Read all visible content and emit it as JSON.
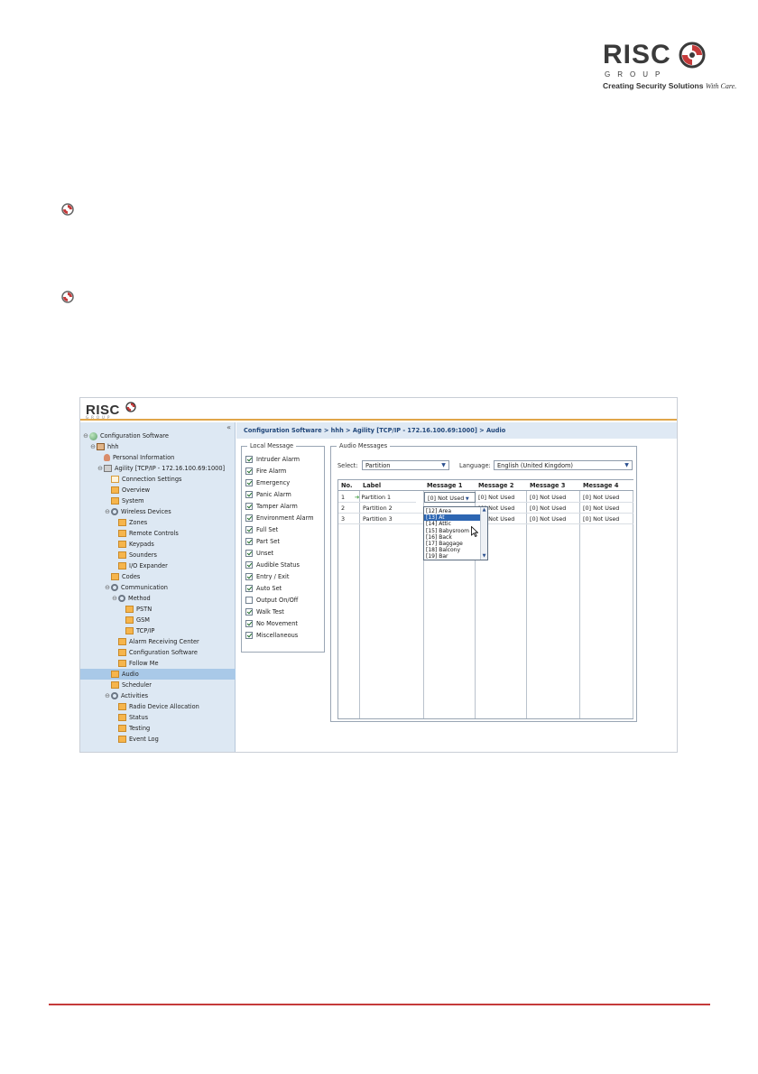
{
  "brand": {
    "logo_word": "RISC",
    "logo_group": "GROUP",
    "tagline": "Creating Security Solutions",
    "tagline_script": "With Care."
  },
  "app": {
    "logo_word": "RISC",
    "logo_group": "GROUP",
    "collapse_symbol": "«",
    "breadcrumb": "Configuration Software > hhh > Agility [TCP/IP - 172.16.100.69:1000] > Audio",
    "tree": [
      {
        "label": "Configuration Software",
        "icon": "globe-icon",
        "toggle": "⊖"
      },
      {
        "label": "hhh",
        "icon": "house-icon",
        "toggle": "⊖"
      },
      {
        "label": "Personal Information",
        "icon": "person-icon",
        "toggle": ""
      },
      {
        "label": "Agility [TCP/IP - 172.16.100.69:1000]",
        "icon": "panel-icon",
        "toggle": "⊖"
      },
      {
        "label": "Connection Settings",
        "icon": "page-icon",
        "toggle": ""
      },
      {
        "label": "Overview",
        "icon": "folder-icon",
        "toggle": ""
      },
      {
        "label": "System",
        "icon": "folder-icon",
        "toggle": ""
      },
      {
        "label": "Wireless Devices",
        "icon": "gear-icon",
        "toggle": "⊖"
      },
      {
        "label": "Zones",
        "icon": "folder-icon",
        "toggle": ""
      },
      {
        "label": "Remote Controls",
        "icon": "folder-icon",
        "toggle": ""
      },
      {
        "label": "Keypads",
        "icon": "folder-icon",
        "toggle": ""
      },
      {
        "label": "Sounders",
        "icon": "folder-icon",
        "toggle": ""
      },
      {
        "label": "I/O Expander",
        "icon": "folder-icon",
        "toggle": ""
      },
      {
        "label": "Codes",
        "icon": "folder-icon",
        "toggle": ""
      },
      {
        "label": "Communication",
        "icon": "gear-icon",
        "toggle": "⊖"
      },
      {
        "label": "Method",
        "icon": "gear-icon",
        "toggle": "⊖"
      },
      {
        "label": "PSTN",
        "icon": "folder-icon",
        "toggle": ""
      },
      {
        "label": "GSM",
        "icon": "folder-icon",
        "toggle": ""
      },
      {
        "label": "TCP/IP",
        "icon": "folder-icon",
        "toggle": ""
      },
      {
        "label": "Alarm Receiving Center",
        "icon": "folder-icon",
        "toggle": ""
      },
      {
        "label": "Configuration Software",
        "icon": "folder-icon",
        "toggle": ""
      },
      {
        "label": "Follow Me",
        "icon": "folder-icon",
        "toggle": ""
      },
      {
        "label": "Audio",
        "icon": "folder-icon",
        "toggle": ""
      },
      {
        "label": "Scheduler",
        "icon": "folder-icon",
        "toggle": ""
      },
      {
        "label": "Activities",
        "icon": "gear-icon",
        "toggle": "⊖"
      },
      {
        "label": "Radio Device Allocation",
        "icon": "folder-icon",
        "toggle": ""
      },
      {
        "label": "Status",
        "icon": "folder-icon",
        "toggle": ""
      },
      {
        "label": "Testing",
        "icon": "folder-icon",
        "toggle": ""
      },
      {
        "label": "Event Log",
        "icon": "folder-icon",
        "toggle": ""
      }
    ],
    "local_message": {
      "title": "Local Message",
      "items": [
        {
          "label": "Intruder Alarm",
          "checked": true
        },
        {
          "label": "Fire Alarm",
          "checked": true
        },
        {
          "label": "Emergency",
          "checked": true
        },
        {
          "label": "Panic Alarm",
          "checked": true
        },
        {
          "label": "Tamper Alarm",
          "checked": true
        },
        {
          "label": "Environment Alarm",
          "checked": true
        },
        {
          "label": "Full Set",
          "checked": true
        },
        {
          "label": "Part Set",
          "checked": true
        },
        {
          "label": "Unset",
          "checked": true
        },
        {
          "label": "Audible Status",
          "checked": true
        },
        {
          "label": "Entry / Exit",
          "checked": true
        },
        {
          "label": "Auto Set",
          "checked": true
        },
        {
          "label": "Output On/Off",
          "checked": false
        },
        {
          "label": "Walk Test",
          "checked": true
        },
        {
          "label": "No Movement",
          "checked": true
        },
        {
          "label": "Miscellaneous",
          "checked": true
        }
      ]
    },
    "audio_messages": {
      "title": "Audio Messages",
      "select_label": "Select:",
      "select_value": "Partition",
      "language_label": "Language:",
      "language_value": "English (United Kingdom)",
      "columns": [
        "No.",
        "Label",
        "Message 1",
        "Message 2",
        "Message 3",
        "Message 4"
      ],
      "rows": [
        {
          "no": "1",
          "label": "Partition 1",
          "m1": "[0] Not Used",
          "m2": "[0] Not Used",
          "m3": "[0] Not Used",
          "m4": "[0] Not Used"
        },
        {
          "no": "2",
          "label": "Partition 2",
          "m1": "",
          "m2": "[0] Not Used",
          "m3": "[0] Not Used",
          "m4": "[0] Not Used"
        },
        {
          "no": "3",
          "label": "Partition 3",
          "m1": "",
          "m2": "[0] Not Used",
          "m3": "[0] Not Used",
          "m4": "[0] Not Used"
        }
      ],
      "dropdown_options": [
        "[12] Area",
        "[13] At",
        "[14] Attic",
        "[15] Babysroom",
        "[16] Back",
        "[17] Baggage",
        "[18] Balcony",
        "[19] Bar"
      ],
      "dropdown_highlighted": "[13] At"
    }
  },
  "colors": {
    "accent_red": "#c53a3a",
    "header_orange": "#e0a64a",
    "sidebar_bg": "#dde8f3",
    "selection_blue": "#2d66b2"
  }
}
